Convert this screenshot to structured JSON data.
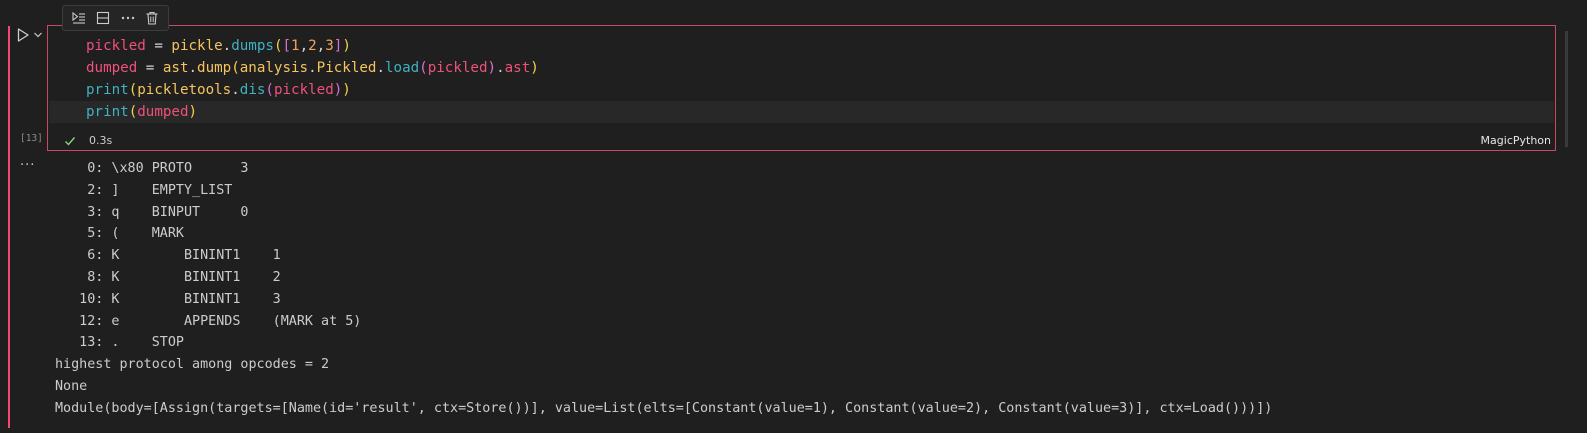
{
  "toolbar": {
    "icons": [
      "run-by-line-icon",
      "split-cell-icon",
      "more-actions-icon",
      "delete-icon"
    ]
  },
  "cell": {
    "execution_count": "[13]",
    "duration": "0.3s",
    "language": "MagicPython",
    "code_lines": [
      [
        {
          "t": "pickled",
          "c": "tok-var"
        },
        {
          "t": " = ",
          "c": "tok-op"
        },
        {
          "t": "pickle",
          "c": "tok-mod"
        },
        {
          "t": ".",
          "c": "tok-op"
        },
        {
          "t": "dumps",
          "c": "tok-fn"
        },
        {
          "t": "(",
          "c": "tok-p1"
        },
        {
          "t": "[",
          "c": "tok-p2"
        },
        {
          "t": "1",
          "c": "tok-num"
        },
        {
          "t": ",",
          "c": "tok-op"
        },
        {
          "t": "2",
          "c": "tok-num"
        },
        {
          "t": ",",
          "c": "tok-op"
        },
        {
          "t": "3",
          "c": "tok-num"
        },
        {
          "t": "]",
          "c": "tok-p2"
        },
        {
          "t": ")",
          "c": "tok-p1"
        }
      ],
      [
        {
          "t": "dumped",
          "c": "tok-var"
        },
        {
          "t": " = ",
          "c": "tok-op"
        },
        {
          "t": "ast",
          "c": "tok-mod"
        },
        {
          "t": ".",
          "c": "tok-op"
        },
        {
          "t": "dump",
          "c": "tok-mod"
        },
        {
          "t": "(",
          "c": "tok-p1"
        },
        {
          "t": "analysis",
          "c": "tok-mod"
        },
        {
          "t": ".",
          "c": "tok-op"
        },
        {
          "t": "Pickled",
          "c": "tok-mod"
        },
        {
          "t": ".",
          "c": "tok-op"
        },
        {
          "t": "load",
          "c": "tok-fn"
        },
        {
          "t": "(",
          "c": "tok-p2"
        },
        {
          "t": "pickled",
          "c": "tok-var"
        },
        {
          "t": ")",
          "c": "tok-p2"
        },
        {
          "t": ".",
          "c": "tok-op"
        },
        {
          "t": "ast",
          "c": "tok-attr"
        },
        {
          "t": ")",
          "c": "tok-p1"
        }
      ],
      [
        {
          "t": "print",
          "c": "tok-fn"
        },
        {
          "t": "(",
          "c": "tok-p1"
        },
        {
          "t": "pickletools",
          "c": "tok-mod"
        },
        {
          "t": ".",
          "c": "tok-op"
        },
        {
          "t": "dis",
          "c": "tok-fn"
        },
        {
          "t": "(",
          "c": "tok-p2"
        },
        {
          "t": "pickled",
          "c": "tok-var"
        },
        {
          "t": ")",
          "c": "tok-p2"
        },
        {
          "t": ")",
          "c": "tok-p1"
        }
      ],
      [
        {
          "t": "print",
          "c": "tok-fn"
        },
        {
          "t": "(",
          "c": "tok-p1"
        },
        {
          "t": "dumped",
          "c": "tok-var"
        },
        {
          "t": ")",
          "c": "tok-p1"
        }
      ]
    ]
  },
  "output": {
    "more_label": "···",
    "lines": [
      "    0: \\x80 PROTO      3",
      "    2: ]    EMPTY_LIST",
      "    3: q    BINPUT     0",
      "    5: (    MARK",
      "    6: K        BININT1    1",
      "    8: K        BININT1    2",
      "   10: K        BININT1    3",
      "   12: e        APPENDS    (MARK at 5)",
      "   13: .    STOP",
      "highest protocol among opcodes = 2",
      "None",
      "Module(body=[Assign(targets=[Name(id='result', ctx=Store())], value=List(elts=[Constant(value=1), Constant(value=2), Constant(value=3)], ctx=Load()))])"
    ]
  },
  "colors": {
    "accent": "#f14c6f",
    "background": "#1f1f1f"
  }
}
